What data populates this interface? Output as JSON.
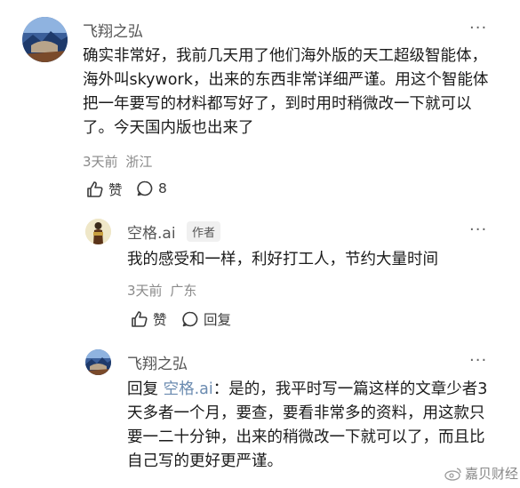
{
  "comment1": {
    "username": "飞翔之弘",
    "text": "确实非常好，我前几天用了他们海外版的天工超级智能体，海外叫skywork，出来的东西非常详细严谨。用这个智能体把一年要写的材料都写好了，到时用时稍微改一下就可以了。今天国内版也出来了",
    "time": "3天前",
    "location": "浙江",
    "like_label": "赞",
    "reply_count": "8",
    "more_icon": "more-dots-icon"
  },
  "reply1": {
    "username": "空格.ai",
    "badge": "作者",
    "text": "我的感受和一样，利好打工人，节约大量时间",
    "time": "3天前",
    "location": "广东",
    "like_label": "赞",
    "reply_label": "回复"
  },
  "reply2": {
    "username": "飞翔之弘",
    "reply_prefix": "回复",
    "reply_to": "空格.ai",
    "text": "：是的，我平时写一篇这样的文章少者3天多者一个月，要查，要看非常多的资料，用这款只要一二十分钟，出来的稍微改一下就可以了，而且比自己写的更好更严谨。"
  },
  "watermark": "嘉贝财经",
  "colors": {
    "link": "#6b8bb0",
    "meta": "#8a8a8a"
  }
}
